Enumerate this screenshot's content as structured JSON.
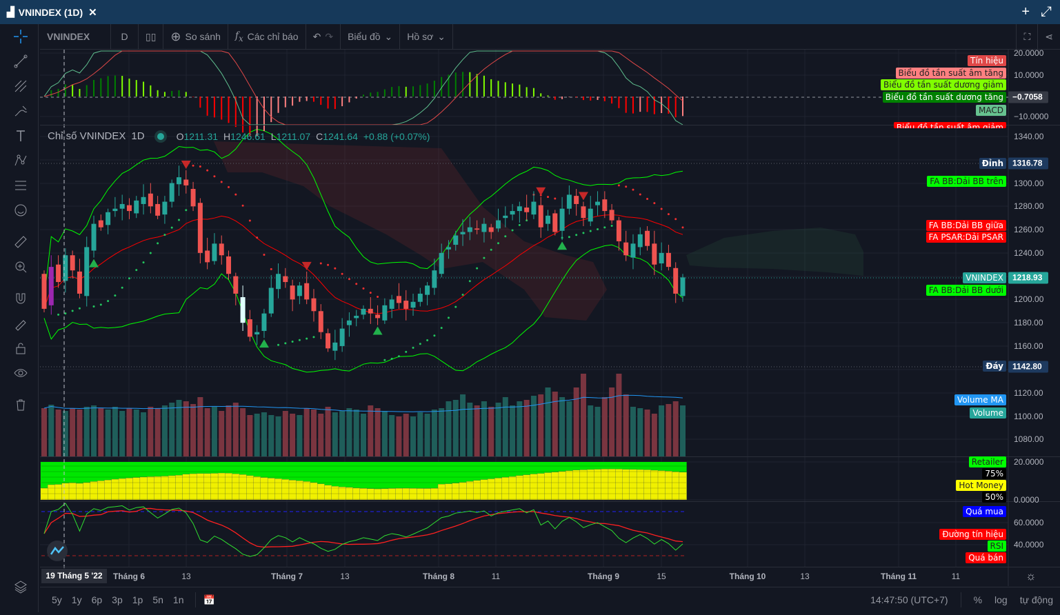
{
  "window": {
    "title": "VNINDEX (1D)",
    "close": "✕",
    "add": "+",
    "expand": "⤢"
  },
  "toolbar": {
    "symbol": "VNINDEX",
    "interval": "D",
    "compare": "So sánh",
    "indicators": "Các chỉ báo",
    "chart": "Biểu đồ",
    "profile": "Hồ sơ"
  },
  "legend": {
    "name": "Chỉ số VNINDEX",
    "interval": "1D",
    "o_label": "O",
    "o": "1211.31",
    "h_label": "H",
    "h": "1246.61",
    "l_label": "L",
    "l": "1211.07",
    "c_label": "C",
    "c": "1241.64",
    "change": "+0.88 (+0.07%)"
  },
  "axis": {
    "macd_ticks": [
      "20.0000",
      "10.0000",
      "−10.0000"
    ],
    "price_ticks": [
      "1340.00",
      "1300.00",
      "1280.00",
      "1260.00",
      "1240.00",
      "1200.00",
      "1180.00",
      "1160.00",
      "1120.00",
      "1100.00",
      "1080.00"
    ],
    "money_ticks": [
      "20.0000",
      "0.0000"
    ],
    "rsi_ticks": [
      "60.0000",
      "40.0000"
    ],
    "macd_value": "−0.7058",
    "top_value": "1316.78",
    "last_value": "1218.93",
    "bottom_value": "1142.80"
  },
  "tags": {
    "signal": "Tín hiệu",
    "neg_up": "Biểu đồ tần suất âm tăng",
    "pos_down": "Biểu đồ tần suất dương giảm",
    "pos_up": "Biểu đồ tần suất dương tăng",
    "macd": "MACD",
    "neg_down": "Biểu đồ tần suất âm giảm",
    "top": "Đỉnh",
    "bb_upper": "FA BB:Dải BB trên",
    "bb_mid": "FA BB:Dải BB giữa",
    "psar": "FA PSAR:Dải PSAR",
    "vnindex": "VNINDEX",
    "bb_lower": "FA BB:Dải BB dưới",
    "bottom": "Đáy",
    "volume_ma": "Volume MA",
    "volume": "Volume",
    "retailer": "Retailer",
    "p75": "75%",
    "hot_money": "Hot Money",
    "p50": "50%",
    "overbought": "Quá mua",
    "signal_line": "Đường tín hiệu",
    "rsi": "RSI",
    "oversold": "Quá bán"
  },
  "time_axis": {
    "cursor_date": "19 Tháng 5 '22",
    "labels": [
      "Tháng 6",
      "13",
      "Tháng 7",
      "13",
      "Tháng 8",
      "11",
      "Tháng 9",
      "15",
      "Tháng 10",
      "13",
      "Tháng 11",
      "11"
    ]
  },
  "bottom": {
    "ranges": [
      "5y",
      "1y",
      "6p",
      "3p",
      "1p",
      "5n",
      "1n"
    ],
    "time": "14:47:50 (UTC+7)",
    "percent": "%",
    "log": "log",
    "auto": "tự động"
  },
  "colors": {
    "up": "#26a69a",
    "down": "#ef5350",
    "bb_upper": "#00ff00",
    "bb_mid": "#ff0000",
    "vol_ma": "#2196f3"
  },
  "chart_data": {
    "type": "candlestick",
    "closes": [
      1192,
      1228,
      1215,
      1238,
      1225,
      1205,
      1245,
      1265,
      1262,
      1275,
      1278,
      1282,
      1276,
      1285,
      1288,
      1280,
      1272,
      1284,
      1300,
      1305,
      1298,
      1280,
      1240,
      1232,
      1248,
      1238,
      1222,
      1205,
      1180,
      1168,
      1172,
      1188,
      1210,
      1222,
      1215,
      1200,
      1212,
      1200,
      1190,
      1172,
      1158,
      1163,
      1175,
      1182,
      1186,
      1192,
      1188,
      1184,
      1195,
      1200,
      1197,
      1192,
      1198,
      1205,
      1212,
      1225,
      1240,
      1245,
      1255,
      1258,
      1262,
      1260,
      1265,
      1258,
      1268,
      1272,
      1276,
      1280,
      1275,
      1284,
      1262,
      1272,
      1258,
      1278,
      1290,
      1282,
      1270,
      1278,
      1284,
      1276,
      1268,
      1250,
      1238,
      1248,
      1256,
      1246,
      1230,
      1240,
      1228,
      1205,
      1219
    ],
    "first_open": 1222,
    "volumes": [
      70,
      75,
      68,
      66,
      70,
      68,
      72,
      74,
      70,
      68,
      72,
      66,
      70,
      68,
      64,
      72,
      70,
      74,
      78,
      82,
      80,
      76,
      86,
      70,
      72,
      66,
      74,
      78,
      70,
      60,
      62,
      64,
      60,
      58,
      66,
      62,
      60,
      70,
      68,
      62,
      72,
      64,
      66,
      70,
      68,
      62,
      74,
      70,
      66,
      60,
      58,
      62,
      58,
      64,
      62,
      68,
      70,
      80,
      82,
      90,
      78,
      74,
      80,
      72,
      78,
      86,
      74,
      80,
      82,
      88,
      90,
      100,
      94,
      86,
      80,
      100,
      120,
      74,
      72,
      86,
      100,
      120,
      90,
      72,
      70,
      68,
      62,
      74,
      76,
      80,
      74
    ],
    "buy_signals": [
      7,
      31,
      47,
      73
    ],
    "sell_signals": [
      20,
      37,
      70,
      76
    ],
    "highlight_bars": {
      "1": "#9c27b0",
      "28": "#e0ffff"
    }
  }
}
